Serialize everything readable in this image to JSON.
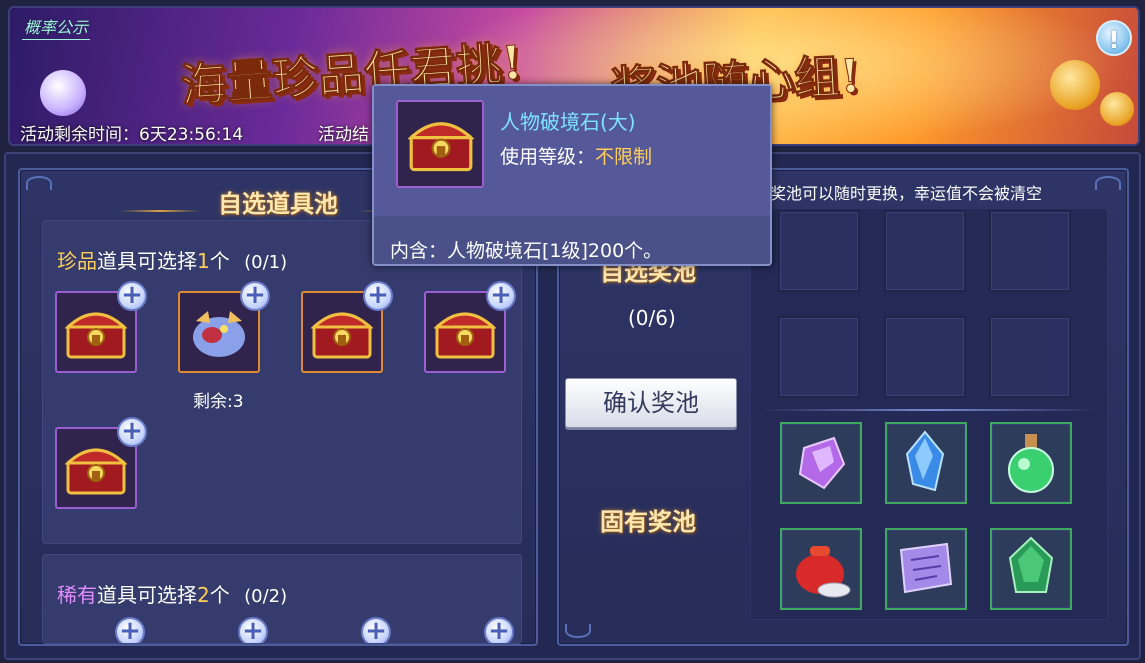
{
  "banner": {
    "prob_link": "概率公示",
    "slogan_1": "海量珍品任君挑!",
    "slogan_2": "奖池随心组!",
    "time_label": "活动剩余时间：",
    "time_value": "6天23:56:14",
    "activity_label": "活动结"
  },
  "left_panel": {
    "title": "自选道具池",
    "rare_section": {
      "prefix": "珍品",
      "mid": "道具可选择",
      "count": "1",
      "suffix": "个",
      "progress": "(0/1)"
    },
    "items": [
      {
        "icon": "treasure-chest",
        "frame": "purple"
      },
      {
        "icon": "dragon-pet",
        "frame": "orange",
        "remain": "剩余:3"
      },
      {
        "icon": "treasure-chest",
        "frame": "orange"
      },
      {
        "icon": "treasure-chest",
        "frame": "purple"
      },
      {
        "icon": "treasure-chest",
        "frame": "purple"
      }
    ],
    "epic_section": {
      "prefix": "稀有",
      "mid": "道具可选择",
      "count": "2",
      "suffix": "个",
      "progress": "(0/2)"
    }
  },
  "right_panel": {
    "notice": "奖池可以随时更换，幸运值不会被清空",
    "self_pool_title": "自选奖池",
    "self_pool_count": "(0/6)",
    "confirm_button": "确认奖池",
    "fixed_pool_title": "固有奖池",
    "fixed_items": [
      "purple-gem-icon",
      "blue-crystal-icon",
      "green-potion-icon",
      "red-lucky-bag-icon",
      "purple-scroll-icon",
      "green-stone-icon"
    ]
  },
  "tooltip": {
    "name": "人物破境石(大)",
    "level_label": "使用等级：",
    "level_value": "不限制",
    "desc": "内含：人物破境石[1级]200个。"
  }
}
